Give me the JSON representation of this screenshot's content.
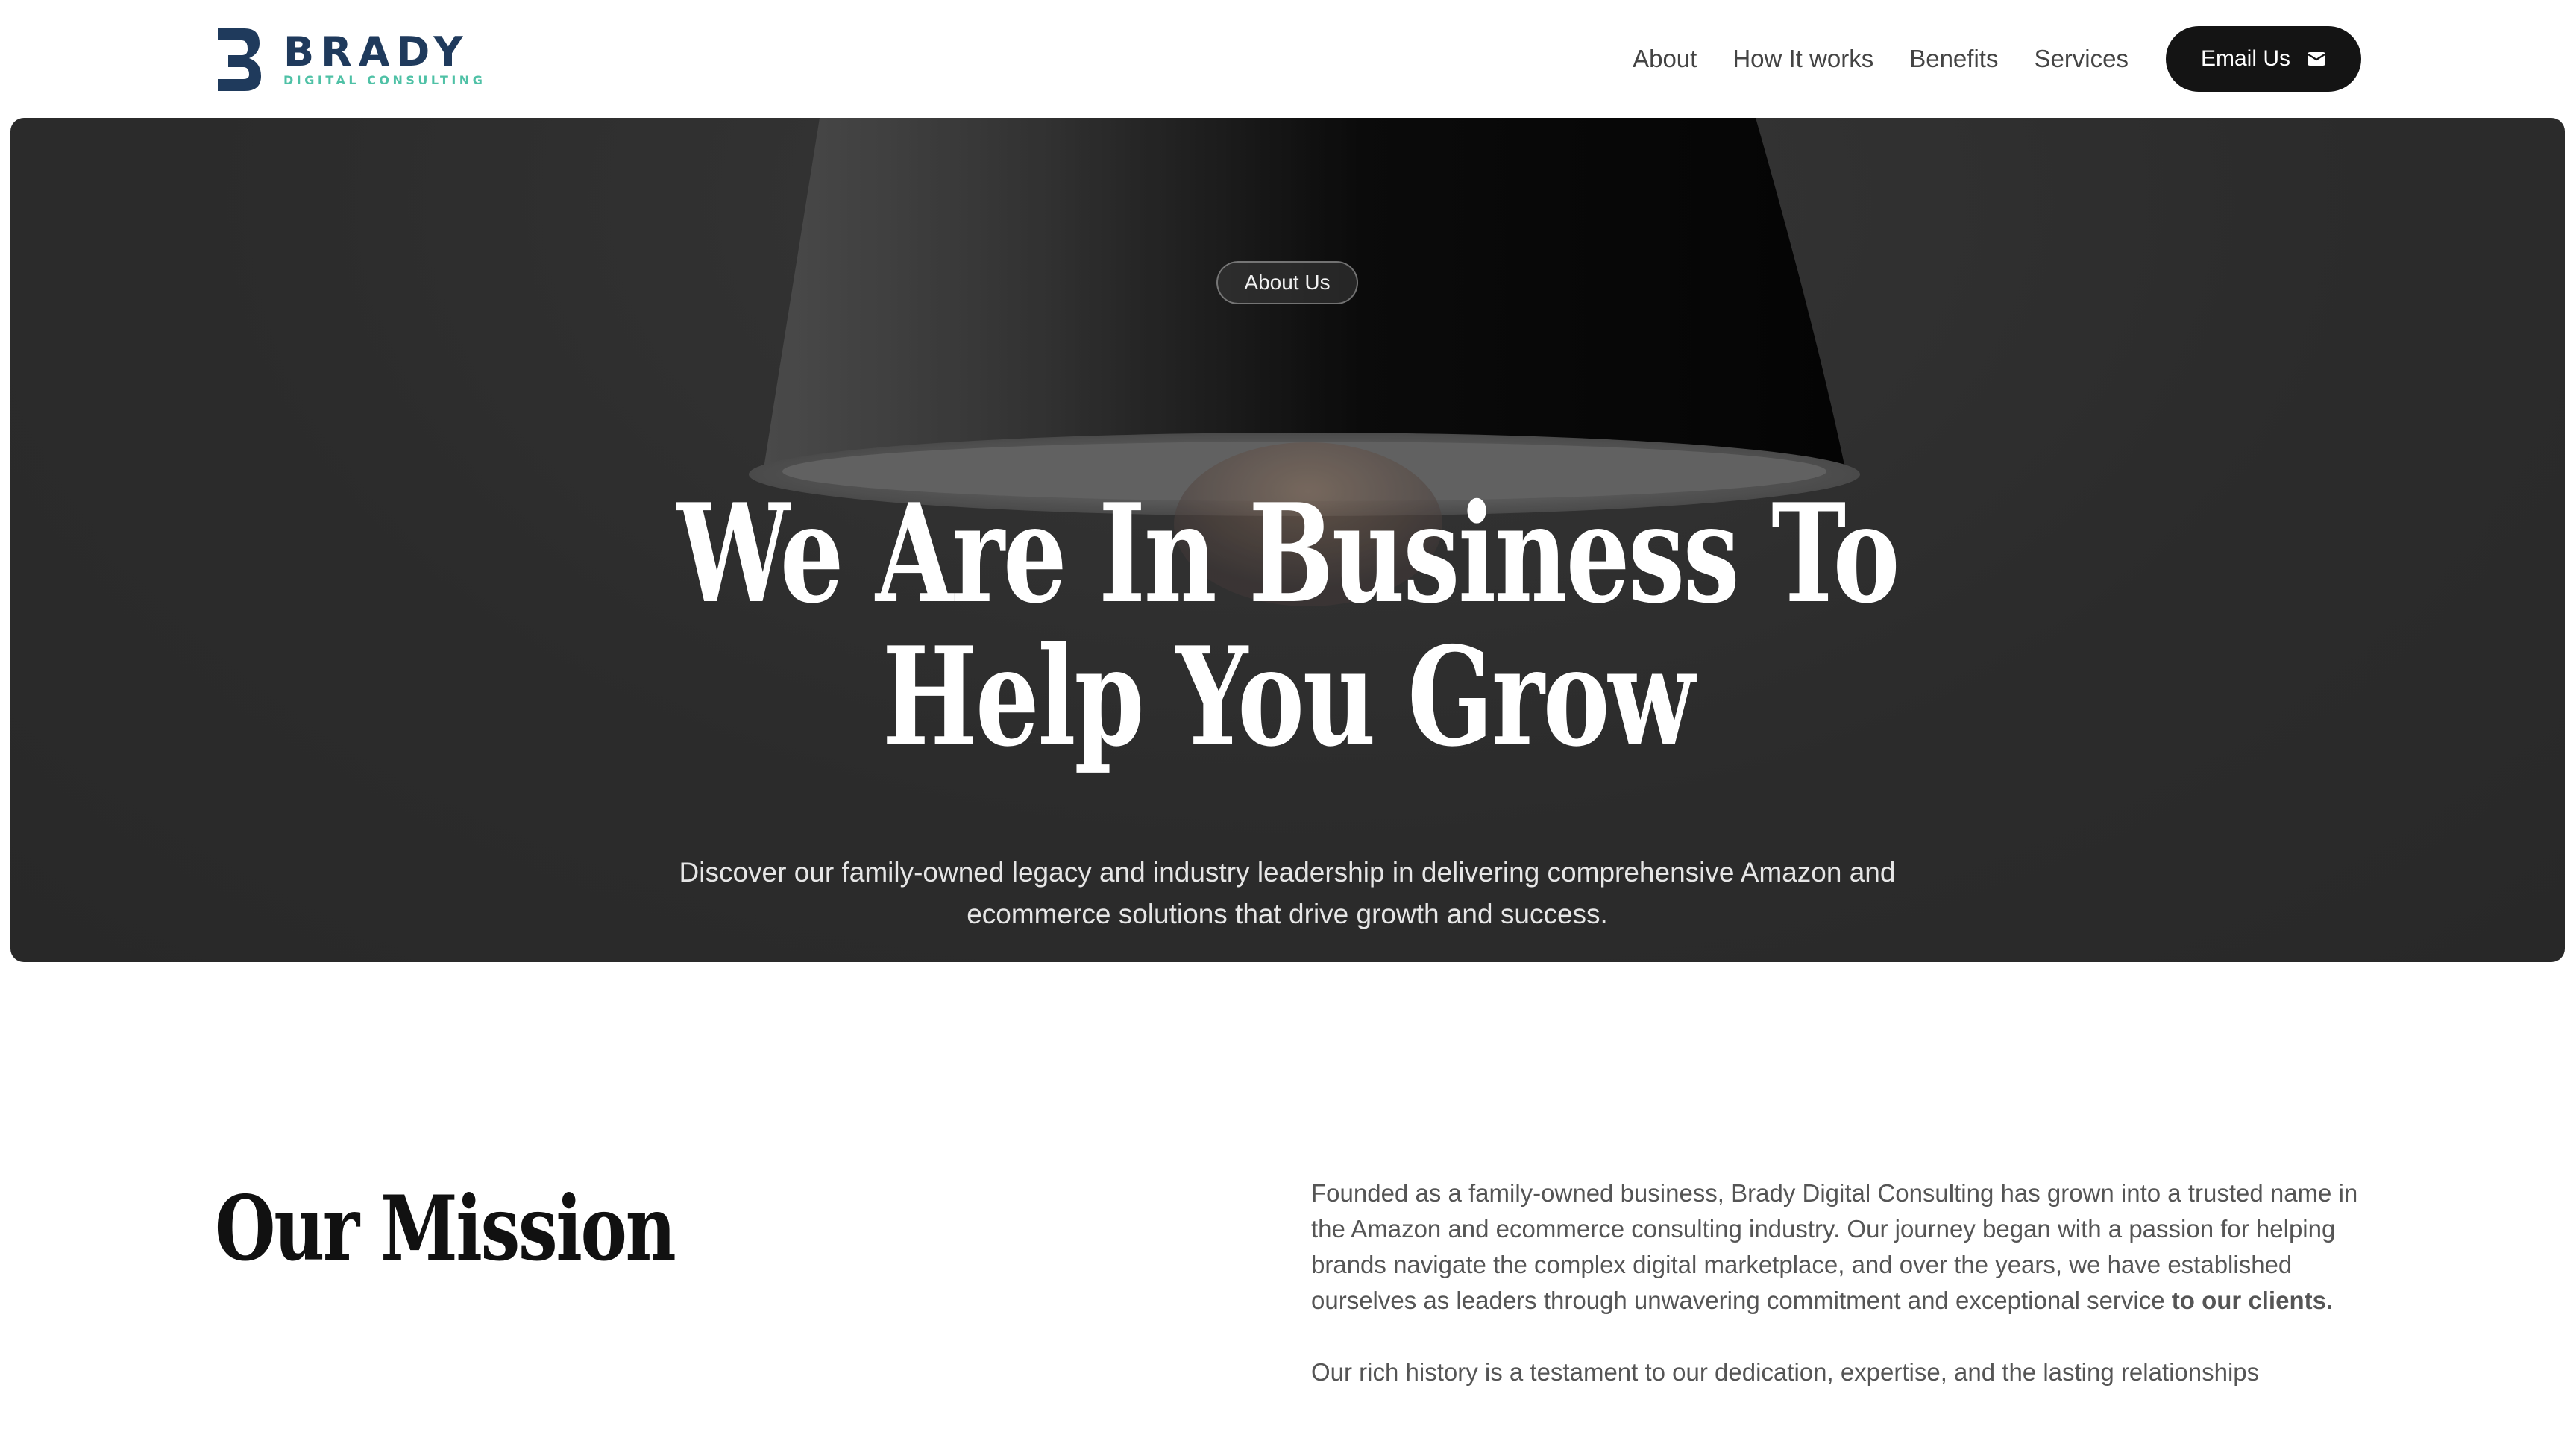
{
  "brand": {
    "name": "BRADY",
    "tagline": "DIGITAL CONSULTING",
    "primary_color": "#1f3a5c",
    "accent_color": "#4fc1a6"
  },
  "nav": {
    "items": [
      "About",
      "How It works",
      "Benefits",
      "Services"
    ],
    "cta_label": "Email Us",
    "cta_icon": "mail-icon"
  },
  "hero": {
    "badge": "About Us",
    "title_line1": "We Are In Business To",
    "title_line2": "Help You Grow",
    "description": "Discover our family-owned legacy and industry leadership in delivering comprehensive Amazon and ecommerce solutions that drive growth and success."
  },
  "mission": {
    "title": "Our Mission",
    "paragraph1": "Founded as a family-owned business, Brady Digital Consulting has grown into a trusted name in the Amazon and ecommerce consulting industry. Our journey began with a passion for helping brands navigate the complex digital marketplace, and over the years, we have established ourselves as leaders through unwavering commitment and exceptional service",
    "paragraph1_bold": "to our clients.",
    "paragraph2": "Our rich history is a testament to our dedication, expertise, and the lasting relationships"
  }
}
